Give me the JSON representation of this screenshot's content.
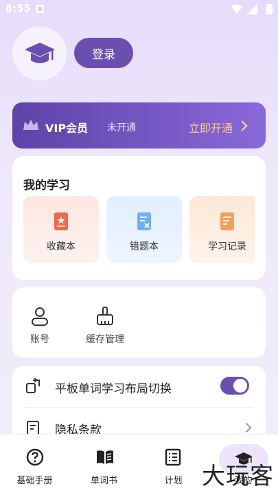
{
  "status_bar": {
    "time": "8:55"
  },
  "profile": {
    "login_label": "登录"
  },
  "vip": {
    "title": "VIP会员",
    "status": "未开通",
    "action": "立即开通",
    "accent": "#f5cf8a"
  },
  "my_study": {
    "heading": "我的学习",
    "items": [
      {
        "label": "收藏本",
        "icon": "bookmark-book-icon"
      },
      {
        "label": "错题本",
        "icon": "wrong-answers-icon"
      },
      {
        "label": "学习记录",
        "icon": "study-record-icon"
      }
    ]
  },
  "tools": [
    {
      "label": "账号",
      "icon": "account-icon"
    },
    {
      "label": "缓存管理",
      "icon": "broom-icon"
    }
  ],
  "settings": [
    {
      "label": "平板单词学习布局切换",
      "icon": "layout-switch-icon",
      "toggle_on": true
    },
    {
      "label": "隐私条款",
      "icon": "privacy-icon"
    }
  ],
  "tabs": [
    {
      "label": "基础手册",
      "icon": "question-circle-icon"
    },
    {
      "label": "单词书",
      "icon": "open-book-icon"
    },
    {
      "label": "计划",
      "icon": "plan-list-icon"
    },
    {
      "label": "我的",
      "icon": "graduation-cap-icon",
      "active": true
    }
  ],
  "watermark": "大玩客",
  "colors": {
    "primary": "#6a4fb1",
    "background": "#e6dcfb"
  }
}
